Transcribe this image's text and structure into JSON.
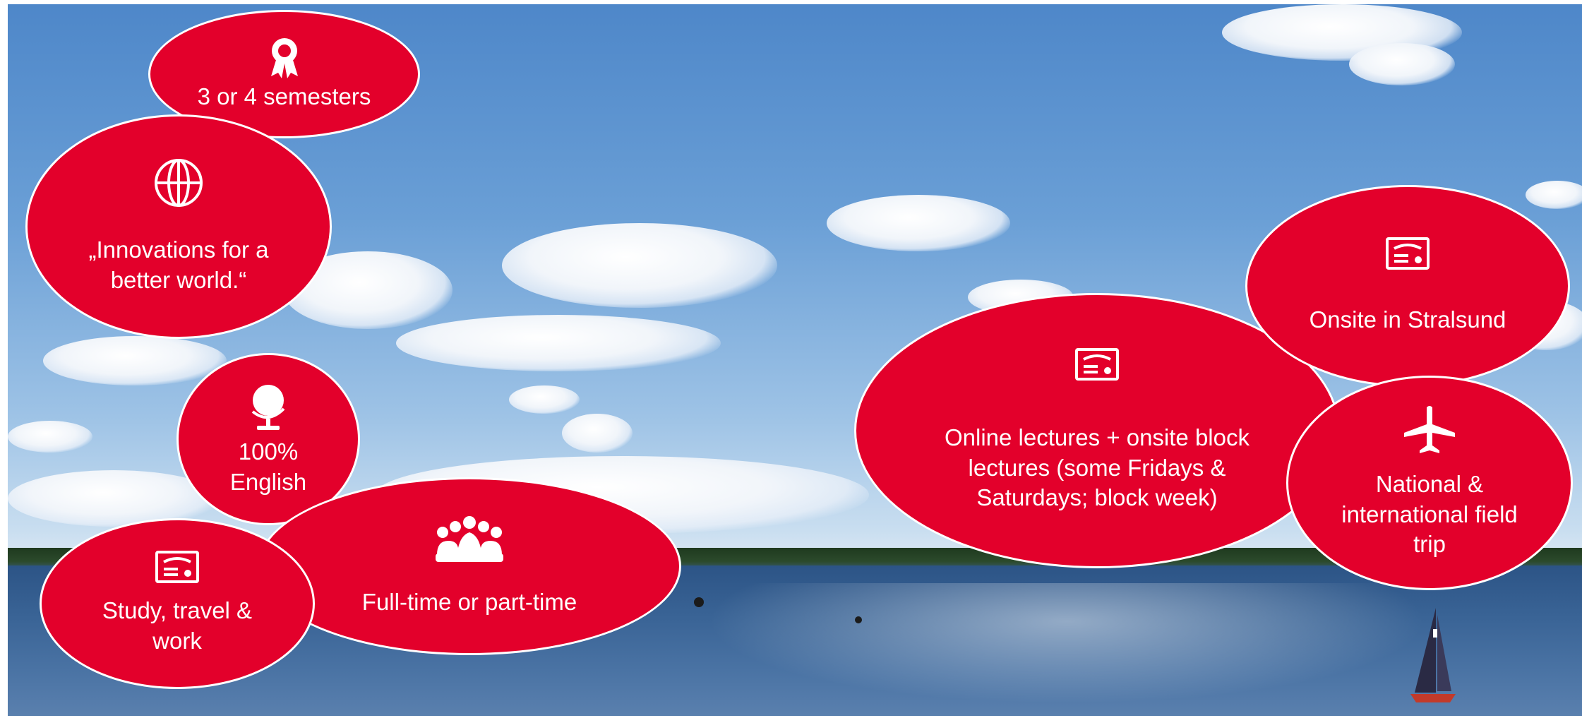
{
  "colors": {
    "bubble": "#e3002b",
    "text": "#ffffff",
    "sky": "#6a9fd6",
    "water": "#3a6496"
  },
  "bubbles": {
    "semesters": {
      "icon": "award-ribbon-icon",
      "text": "3 or 4 semesters"
    },
    "innovations": {
      "icon": "globe-grid-icon",
      "text": "„Innovations for a better world.“"
    },
    "english": {
      "icon": "desk-globe-icon",
      "text": "100% English"
    },
    "fulltime": {
      "icon": "group-people-icon",
      "text": "Full-time or part-time"
    },
    "study": {
      "icon": "certificate-icon",
      "text": "Study, travel & work"
    },
    "online": {
      "icon": "certificate-icon",
      "text": "Online lectures + onsite block lectures (some Fridays & Saturdays; block week)"
    },
    "onsite": {
      "icon": "certificate-icon",
      "text": "Onsite in Stralsund"
    },
    "fieldtrip": {
      "icon": "airplane-icon",
      "text": "National & international field trip"
    }
  }
}
